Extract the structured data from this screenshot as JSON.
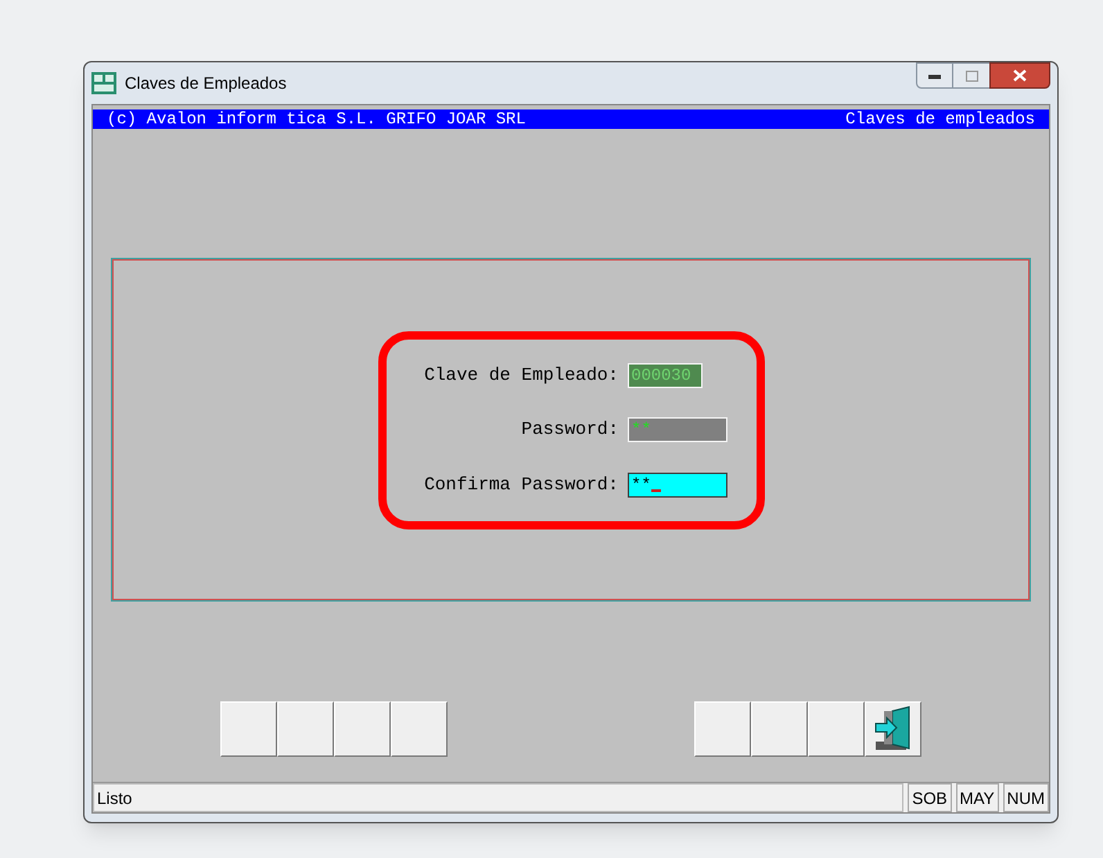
{
  "window": {
    "title": "Claves de Empleados"
  },
  "header": {
    "left": "(c) Avalon inform tica S.L. GRIFO JOAR SRL",
    "right": "Claves de empleados"
  },
  "fields": [
    {
      "label": "Clave de Empleado:",
      "value": "000030",
      "kind": "readonly"
    },
    {
      "label": "Password:",
      "value": "**",
      "kind": "disabled"
    },
    {
      "label": "Confirma Password:",
      "value": "**",
      "kind": "focused"
    }
  ],
  "toolbar_left": [
    {
      "kind": "blank"
    },
    {
      "kind": "blank"
    },
    {
      "kind": "blank"
    },
    {
      "kind": "blank"
    }
  ],
  "toolbar_right": [
    {
      "kind": "blank"
    },
    {
      "kind": "blank"
    },
    {
      "kind": "blank"
    },
    {
      "kind": "exit"
    }
  ],
  "status_bar": {
    "message": "Listo",
    "indicators": [
      "SOB",
      "MAY",
      "NUM"
    ]
  }
}
